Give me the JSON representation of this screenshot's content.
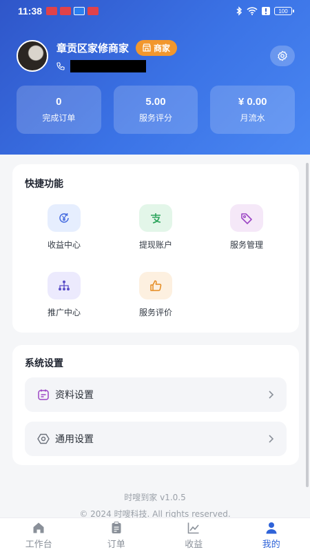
{
  "status_bar": {
    "time": "11:38",
    "battery_label": "100"
  },
  "profile": {
    "shop_name": "章贡区家修商家",
    "badge_label": "商家"
  },
  "stats": [
    {
      "value": "0",
      "label": "完成订单"
    },
    {
      "value": "5.00",
      "label": "服务评分"
    },
    {
      "value": "¥ 0.00",
      "label": "月流水"
    }
  ],
  "quick": {
    "title": "快捷功能",
    "items": [
      {
        "label": "收益中心",
        "icon": "yuan-cycle-icon",
        "color": "#4a6fe0",
        "bg": "#e6eefe"
      },
      {
        "label": "提现账户",
        "icon": "alipay-icon",
        "color": "#2aa35a",
        "bg": "#e3f6e9"
      },
      {
        "label": "服务管理",
        "icon": "tag-icon",
        "color": "#9b45c4",
        "bg": "#f5e8f8"
      },
      {
        "label": "推广中心",
        "icon": "network-icon",
        "color": "#5b4fc8",
        "bg": "#eceafd"
      },
      {
        "label": "服务评价",
        "icon": "thumbs-up-icon",
        "color": "#e58a1f",
        "bg": "#fdf0e0"
      }
    ]
  },
  "system": {
    "title": "系统设置",
    "items": [
      {
        "label": "资料设置"
      },
      {
        "label": "通用设置"
      }
    ]
  },
  "footer": {
    "version": "时嗖到家 v1.0.5",
    "copyright": "© 2024 时嗖科技. All rights reserved."
  },
  "tabs": [
    {
      "label": "工作台",
      "icon": "home-icon"
    },
    {
      "label": "订单",
      "icon": "clipboard-icon"
    },
    {
      "label": "收益",
      "icon": "chart-icon"
    },
    {
      "label": "我的",
      "icon": "user-icon",
      "active": true
    }
  ],
  "colors": {
    "primary": "#2f63d8",
    "badge": "#f2972d",
    "header_gradient_start": "#2f56c9",
    "header_gradient_end": "#4a87f2"
  }
}
